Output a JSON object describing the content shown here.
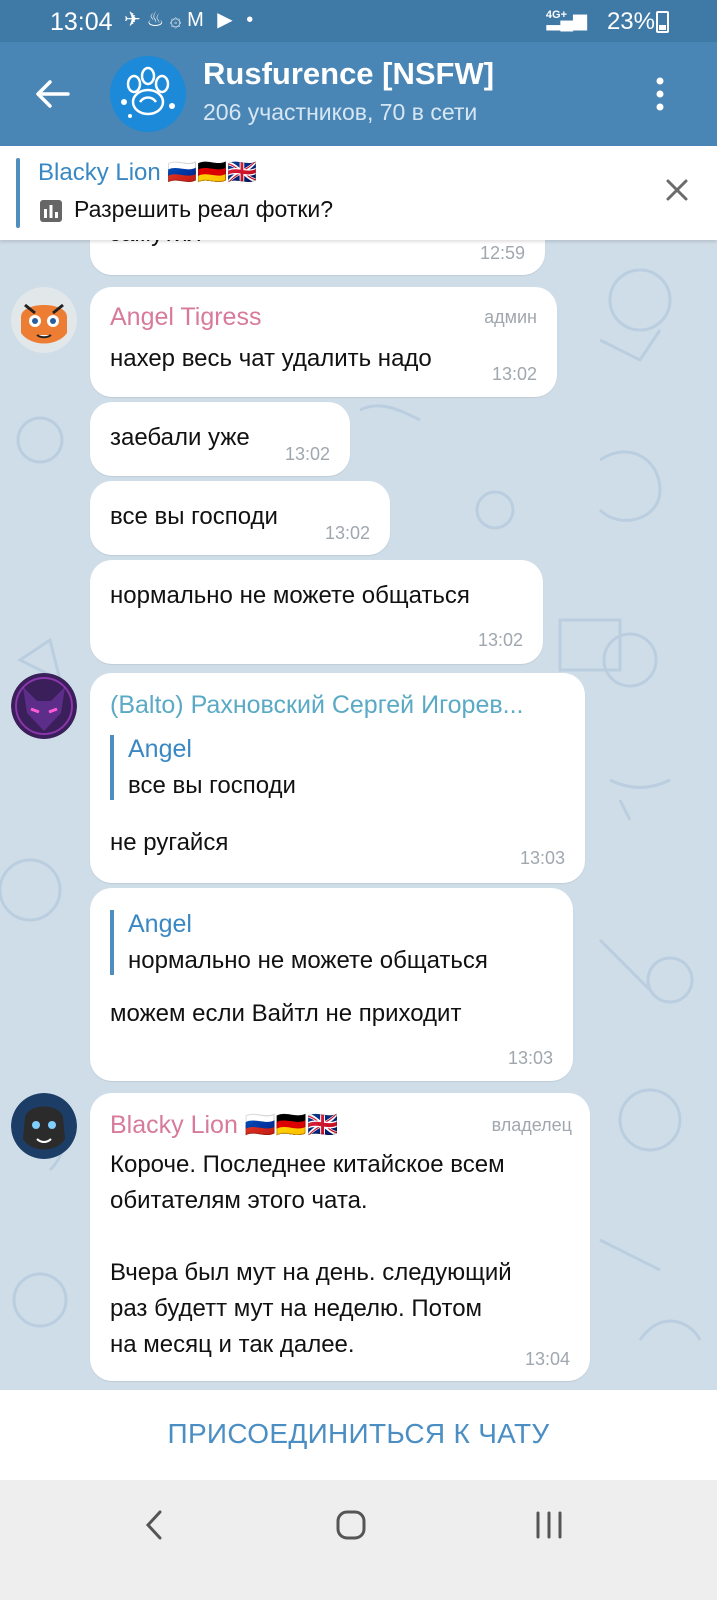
{
  "status": {
    "time": "13:04",
    "icons": "✈ ♨ ۞ M ▶ •",
    "network": "4G+",
    "battery_text": "23%"
  },
  "header": {
    "title": "Rusfurence [NSFW]",
    "subtitle": "206 участников, 70 в сети"
  },
  "pinned": {
    "author": "Blacky Lion 🇷🇺🇩🇪🇬🇧",
    "text": "Разрешить реал фотки?"
  },
  "messages": [
    {
      "text": "замутил",
      "time": "12:59"
    },
    {
      "author": "Angel Tigress",
      "role": "админ",
      "text": "нахер весь чат удалить надо",
      "time": "13:02"
    },
    {
      "text": "заебали уже",
      "time": "13:02"
    },
    {
      "text": "все вы господи",
      "time": "13:02"
    },
    {
      "text": "нормально не можете общаться",
      "time": "13:02"
    },
    {
      "author": "(Balto) Рахновский Сергей Игорев...",
      "reply_name": "Angel",
      "reply_text": "все вы господи",
      "text": "не ругайся",
      "time": "13:03"
    },
    {
      "reply_name": "Angel",
      "reply_text": "нормально не можете общаться",
      "text": "можем если Вайтл не приходит",
      "time": "13:03"
    },
    {
      "author": "Blacky Lion 🇷🇺🇩🇪🇬🇧",
      "role": "владелец",
      "lines": [
        "Короче. Последнее китайское всем",
        "обитателям этого чата.",
        "",
        "Вчера был мут на день. следующий",
        "раз будетт мут на неделю. Потом",
        "на месяц и так далее."
      ],
      "time": "13:04"
    }
  ],
  "join": {
    "label": "ПРИСОЕДИНИТЬСЯ К ЧАТУ"
  },
  "colors": {
    "header": "#4a86b5",
    "accent": "#3a88c3",
    "name_pink": "#d77a9b",
    "name_teal": "#5aaac5",
    "chat_bg": "#cfdde8"
  },
  "icons": {
    "back": "arrow-left-icon",
    "menu": "more-vertical-icon",
    "close": "close-icon",
    "poll": "poll-icon"
  }
}
